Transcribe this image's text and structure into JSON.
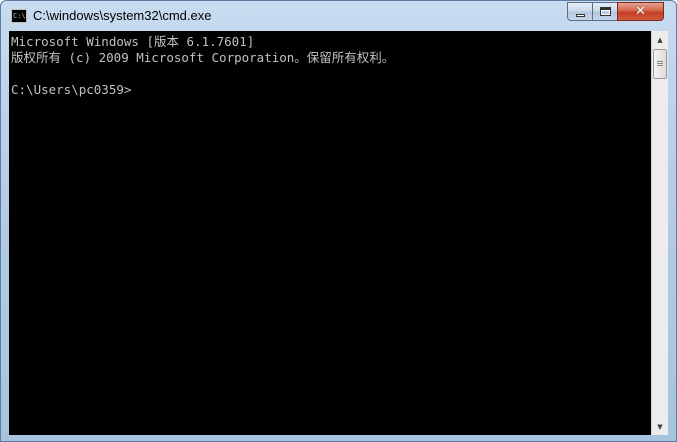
{
  "window": {
    "title": "C:\\windows\\system32\\cmd.exe",
    "app_icon_text": "C:\\",
    "app_icon": "cmd-icon"
  },
  "controls": {
    "minimize_icon": "minimize-icon",
    "maximize_icon": "maximize-icon",
    "close_icon": "close-icon",
    "close_glyph": "✕"
  },
  "console": {
    "lines": [
      "Microsoft Windows [版本 6.1.7601]",
      "版权所有 (c) 2009 Microsoft Corporation。保留所有权利。",
      "C:\\Users\\pc0359>"
    ],
    "background": "#000000",
    "text_color": "#c0c0c0"
  },
  "scrollbar": {
    "up_glyph": "▲",
    "down_glyph": "▼"
  }
}
